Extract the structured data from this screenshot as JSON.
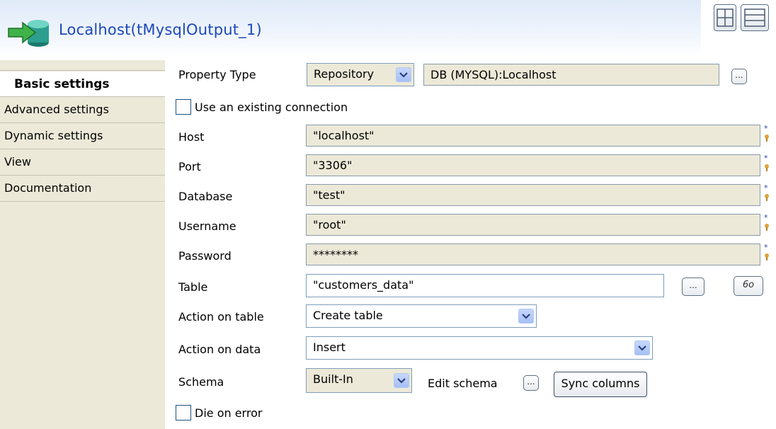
{
  "header": {
    "title": "Localhost(tMysqlOutput_1)",
    "component_icon": "db-output-icon",
    "layout_buttons": [
      "grid-layout-icon",
      "list-layout-icon"
    ]
  },
  "tabs": [
    {
      "label": "Basic settings",
      "active": true
    },
    {
      "label": "Advanced settings",
      "active": false
    },
    {
      "label": "Dynamic settings",
      "active": false
    },
    {
      "label": "View",
      "active": false
    },
    {
      "label": "Documentation",
      "active": false
    }
  ],
  "form": {
    "property_type": {
      "label": "Property Type",
      "value": "Repository",
      "repo": "DB (MYSQL):Localhost",
      "browse": "..."
    },
    "use_existing": {
      "label": "Use an existing connection",
      "checked": false
    },
    "host": {
      "label": "Host",
      "value": "\"localhost\""
    },
    "port": {
      "label": "Port",
      "value": "\"3306\""
    },
    "database": {
      "label": "Database",
      "value": "\"test\""
    },
    "username": {
      "label": "Username",
      "value": "\"root\""
    },
    "password": {
      "label": "Password",
      "value": "********"
    },
    "table": {
      "label": "Table",
      "value": "\"customers_data\"",
      "browse": "...",
      "guess": "6o"
    },
    "action_on_table": {
      "label": "Action on table",
      "value": "Create table"
    },
    "action_on_data": {
      "label": "Action on data",
      "value": "Insert"
    },
    "schema": {
      "label": "Schema",
      "value": "Built-In",
      "edit_label": "Edit schema",
      "edit_browse": "...",
      "sync_label": "Sync columns"
    },
    "die_on_error": {
      "label": "Die on error",
      "checked": false
    }
  },
  "colors": {
    "title": "#1d49b8",
    "field_bg": "#ece9d8",
    "tab_bg": "#ece9d8"
  }
}
